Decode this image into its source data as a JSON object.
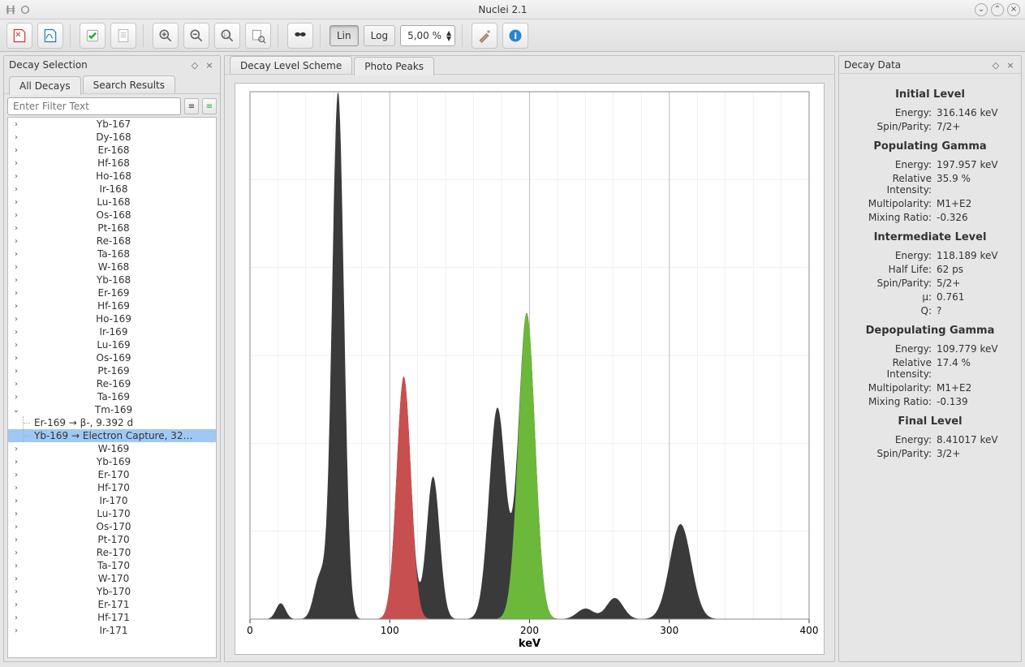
{
  "window": {
    "title": "Nuclei 2.1"
  },
  "toolbar": {
    "lin": "Lin",
    "log": "Log",
    "resolution": "5,00 %"
  },
  "left_panel": {
    "title": "Decay Selection",
    "tabs": {
      "all": "All Decays",
      "search": "Search Results"
    },
    "filter_placeholder": "Enter Filter Text",
    "items": [
      "Yb-167",
      "Dy-168",
      "Er-168",
      "Hf-168",
      "Ho-168",
      "Ir-168",
      "Lu-168",
      "Os-168",
      "Pt-168",
      "Re-168",
      "Ta-168",
      "W-168",
      "Yb-168",
      "Er-169",
      "Hf-169",
      "Ho-169",
      "Ir-169",
      "Lu-169",
      "Os-169",
      "Pt-169",
      "Re-169",
      "Ta-169"
    ],
    "expanded": {
      "label": "Tm-169",
      "children": [
        "Er-169 → β-, 9.392 d",
        "Yb-169 → Electron Capture, 32…"
      ],
      "selected_index": 1
    },
    "items_after": [
      "W-169",
      "Yb-169",
      "Er-170",
      "Hf-170",
      "Ir-170",
      "Lu-170",
      "Os-170",
      "Pt-170",
      "Re-170",
      "Ta-170",
      "W-170",
      "Yb-170",
      "Er-171",
      "Hf-171",
      "Ir-171"
    ]
  },
  "center_panel": {
    "tabs": {
      "scheme": "Decay Level Scheme",
      "peaks": "Photo Peaks"
    },
    "xlabel": "keV"
  },
  "chart_data": {
    "type": "area",
    "xlabel": "keV",
    "ylabel": "",
    "xlim": [
      0,
      400
    ],
    "ylim": [
      0,
      100
    ],
    "xticks": [
      0,
      100,
      200,
      300,
      400
    ],
    "series": [
      {
        "name": "background-spectrum",
        "color": "#3a3a3a",
        "peaks": [
          {
            "center": 22,
            "height": 3,
            "width": 8
          },
          {
            "center": 50,
            "height": 8,
            "width": 10
          },
          {
            "center": 63,
            "height": 100,
            "width": 10
          },
          {
            "center": 110,
            "height": 46,
            "width": 12
          },
          {
            "center": 131,
            "height": 27,
            "width": 11
          },
          {
            "center": 177,
            "height": 40,
            "width": 14
          },
          {
            "center": 198,
            "height": 58,
            "width": 14
          },
          {
            "center": 240,
            "height": 2,
            "width": 14
          },
          {
            "center": 261,
            "height": 4,
            "width": 14
          },
          {
            "center": 308,
            "height": 18,
            "width": 18
          }
        ]
      },
      {
        "name": "depopulating-gamma",
        "color": "#d05050",
        "peaks": [
          {
            "center": 110,
            "height": 46,
            "width": 12
          }
        ]
      },
      {
        "name": "populating-gamma",
        "color": "#6fbf3a",
        "peaks": [
          {
            "center": 198,
            "height": 58,
            "width": 14
          }
        ]
      }
    ]
  },
  "right_panel": {
    "title": "Decay Data",
    "sections": [
      {
        "heading": "Initial Level",
        "rows": [
          {
            "k": "Energy:",
            "v": "316.146 keV"
          },
          {
            "k": "Spin/Parity:",
            "v": "7/2+"
          }
        ]
      },
      {
        "heading": "Populating Gamma",
        "rows": [
          {
            "k": "Energy:",
            "v": "197.957 keV"
          },
          {
            "k": "Relative Intensity:",
            "v": "35.9 %"
          },
          {
            "k": "Multipolarity:",
            "v": "M1+E2"
          },
          {
            "k": "Mixing Ratio:",
            "v": "-0.326"
          }
        ]
      },
      {
        "heading": "Intermediate Level",
        "rows": [
          {
            "k": "Energy:",
            "v": "118.189 keV"
          },
          {
            "k": "Half Life:",
            "v": "62 ps"
          },
          {
            "k": "Spin/Parity:",
            "v": "5/2+"
          },
          {
            "k": "µ:",
            "v": "0.761"
          },
          {
            "k": "Q:",
            "v": "?"
          }
        ]
      },
      {
        "heading": "Depopulating Gamma",
        "rows": [
          {
            "k": "Energy:",
            "v": "109.779 keV"
          },
          {
            "k": "Relative Intensity:",
            "v": "17.4 %"
          },
          {
            "k": "Multipolarity:",
            "v": "M1+E2"
          },
          {
            "k": "Mixing Ratio:",
            "v": "-0.139"
          }
        ]
      },
      {
        "heading": "Final Level",
        "rows": [
          {
            "k": "Energy:",
            "v": "8.41017 keV"
          },
          {
            "k": "Spin/Parity:",
            "v": "3/2+"
          }
        ]
      }
    ]
  }
}
